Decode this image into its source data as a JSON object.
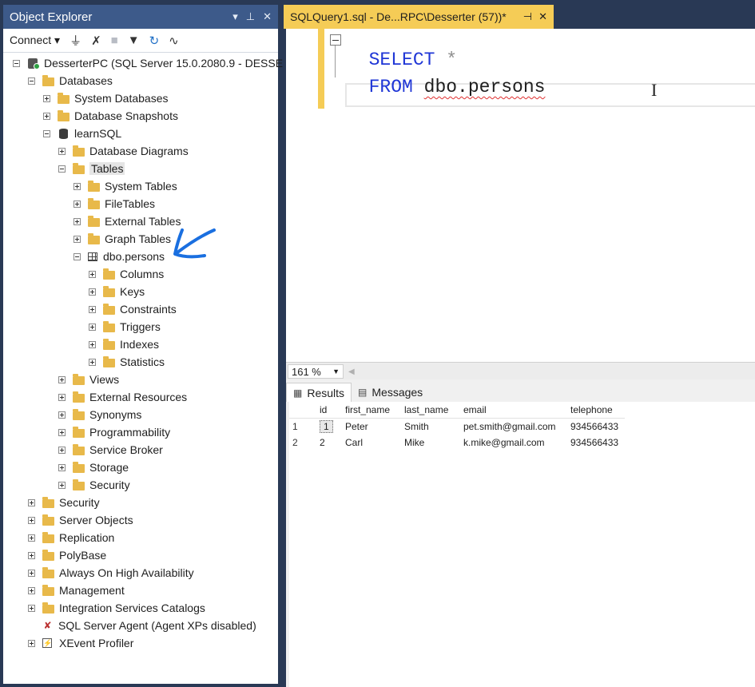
{
  "object_explorer": {
    "title": "Object Explorer",
    "toolbar": {
      "connect_label": "Connect",
      "connect_arrow": "▾"
    },
    "tree": [
      {
        "label": "DesserterPC (SQL Server 15.0.2080.9 - DESSE",
        "icon": "server-icon",
        "expander": "minus"
      },
      {
        "label": "Databases",
        "icon": "folder-icon",
        "expander": "minus"
      },
      {
        "label": "System Databases",
        "icon": "folder-icon",
        "expander": "plus"
      },
      {
        "label": "Database Snapshots",
        "icon": "folder-icon",
        "expander": "plus"
      },
      {
        "label": "learnSQL",
        "icon": "database-icon",
        "expander": "minus"
      },
      {
        "label": "Database Diagrams",
        "icon": "folder-icon",
        "expander": "plus"
      },
      {
        "label": "Tables",
        "icon": "folder-icon",
        "expander": "minus",
        "selected": true
      },
      {
        "label": "System Tables",
        "icon": "folder-icon",
        "expander": "plus"
      },
      {
        "label": "FileTables",
        "icon": "folder-icon",
        "expander": "plus"
      },
      {
        "label": "External Tables",
        "icon": "folder-icon",
        "expander": "plus"
      },
      {
        "label": "Graph Tables",
        "icon": "folder-icon",
        "expander": "plus"
      },
      {
        "label": "dbo.persons",
        "icon": "table-icon",
        "expander": "minus"
      },
      {
        "label": "Columns",
        "icon": "folder-icon",
        "expander": "plus"
      },
      {
        "label": "Keys",
        "icon": "folder-icon",
        "expander": "plus"
      },
      {
        "label": "Constraints",
        "icon": "folder-icon",
        "expander": "plus"
      },
      {
        "label": "Triggers",
        "icon": "folder-icon",
        "expander": "plus"
      },
      {
        "label": "Indexes",
        "icon": "folder-icon",
        "expander": "plus"
      },
      {
        "label": "Statistics",
        "icon": "folder-icon",
        "expander": "plus"
      },
      {
        "label": "Views",
        "icon": "folder-icon",
        "expander": "plus"
      },
      {
        "label": "External Resources",
        "icon": "folder-icon",
        "expander": "plus"
      },
      {
        "label": "Synonyms",
        "icon": "folder-icon",
        "expander": "plus"
      },
      {
        "label": "Programmability",
        "icon": "folder-icon",
        "expander": "plus"
      },
      {
        "label": "Service Broker",
        "icon": "folder-icon",
        "expander": "plus"
      },
      {
        "label": "Storage",
        "icon": "folder-icon",
        "expander": "plus"
      },
      {
        "label": "Security",
        "icon": "folder-icon",
        "expander": "plus"
      },
      {
        "label": "Security",
        "icon": "folder-icon",
        "expander": "plus"
      },
      {
        "label": "Server Objects",
        "icon": "folder-icon",
        "expander": "plus"
      },
      {
        "label": "Replication",
        "icon": "folder-icon",
        "expander": "plus"
      },
      {
        "label": "PolyBase",
        "icon": "folder-icon",
        "expander": "plus"
      },
      {
        "label": "Always On High Availability",
        "icon": "folder-icon",
        "expander": "plus"
      },
      {
        "label": "Management",
        "icon": "folder-icon",
        "expander": "plus"
      },
      {
        "label": "Integration Services Catalogs",
        "icon": "folder-icon",
        "expander": "plus"
      },
      {
        "label": "SQL Server Agent (Agent XPs disabled)",
        "icon": "agent-icon",
        "expander": "none"
      },
      {
        "label": "XEvent Profiler",
        "icon": "xevent-icon",
        "expander": "plus"
      }
    ]
  },
  "document_tab": {
    "title": "SQLQuery1.sql - De...RPC\\Desserter (57))*"
  },
  "editor": {
    "line1": {
      "keyword": "SELECT",
      "rest": "*"
    },
    "line2": {
      "keyword": "FROM",
      "object": "dbo.persons"
    }
  },
  "zoom": {
    "value": "161 %"
  },
  "results": {
    "tabs": [
      {
        "label": "Results",
        "icon": "grid-icon",
        "active": true
      },
      {
        "label": "Messages",
        "icon": "messages-icon",
        "active": false
      }
    ],
    "columns": [
      "id",
      "first_name",
      "last_name",
      "email",
      "telephone"
    ],
    "rows": [
      {
        "num": "1",
        "cells": [
          "1",
          "Peter",
          "Smith",
          "pet.smith@gmail.com",
          "934566433"
        ]
      },
      {
        "num": "2",
        "cells": [
          "2",
          "Carl",
          "Mike",
          "k.mike@gmail.com",
          "934566433"
        ]
      }
    ]
  },
  "colors": {
    "title_bar": "#3d5a8a",
    "tab_active": "#f5cc56",
    "keyword": "#1f36d6",
    "annotation_arrow": "#1a6fe0"
  }
}
